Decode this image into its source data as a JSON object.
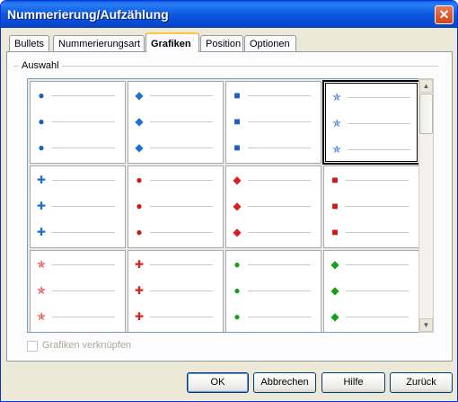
{
  "window": {
    "title": "Nummerierung/Aufzählung"
  },
  "tabs": [
    {
      "label": "Bullets"
    },
    {
      "label": "Nummerierungsart"
    },
    {
      "label": "Grafiken",
      "active": true
    },
    {
      "label": "Position"
    },
    {
      "label": "Optionen"
    }
  ],
  "section": {
    "label": "Auswahl"
  },
  "gallery": {
    "selected_index": 3,
    "rows": [
      [
        {
          "icon": "blue-ball-bullet-icon",
          "glyph": "●",
          "color": "#1f5fc0"
        },
        {
          "icon": "blue-diamond-bullet-icon",
          "glyph": "◆",
          "color": "#1f6fd0"
        },
        {
          "icon": "blue-cube-bullet-icon",
          "glyph": "■",
          "color": "#1f5fc0"
        },
        {
          "icon": "blue-star-bullet-icon",
          "glyph": "✯",
          "color": "#2b6fd0"
        }
      ],
      [
        {
          "icon": "blue-cross-bullet-icon",
          "glyph": "✚",
          "color": "#1f6fd0"
        },
        {
          "icon": "red-ball-bullet-icon",
          "glyph": "●",
          "color": "#d01818"
        },
        {
          "icon": "red-diamond-bullet-icon",
          "glyph": "◆",
          "color": "#d82020"
        },
        {
          "icon": "red-cube-bullet-icon",
          "glyph": "■",
          "color": "#d01818"
        }
      ],
      [
        {
          "icon": "red-star-bullet-icon",
          "glyph": "✯",
          "color": "#d82020"
        },
        {
          "icon": "red-cross-bullet-icon",
          "glyph": "✚",
          "color": "#d82020"
        },
        {
          "icon": "green-ball-bullet-icon",
          "glyph": "●",
          "color": "#17a017"
        },
        {
          "icon": "green-diamond-bullet-icon",
          "glyph": "◆",
          "color": "#17a017"
        }
      ]
    ]
  },
  "link_graphics": {
    "label": "Grafiken verknüpfen",
    "checked": false,
    "disabled": true
  },
  "buttons": {
    "ok": "OK",
    "cancel": "Abbrechen",
    "help": "Hilfe",
    "back": "Zurück"
  }
}
